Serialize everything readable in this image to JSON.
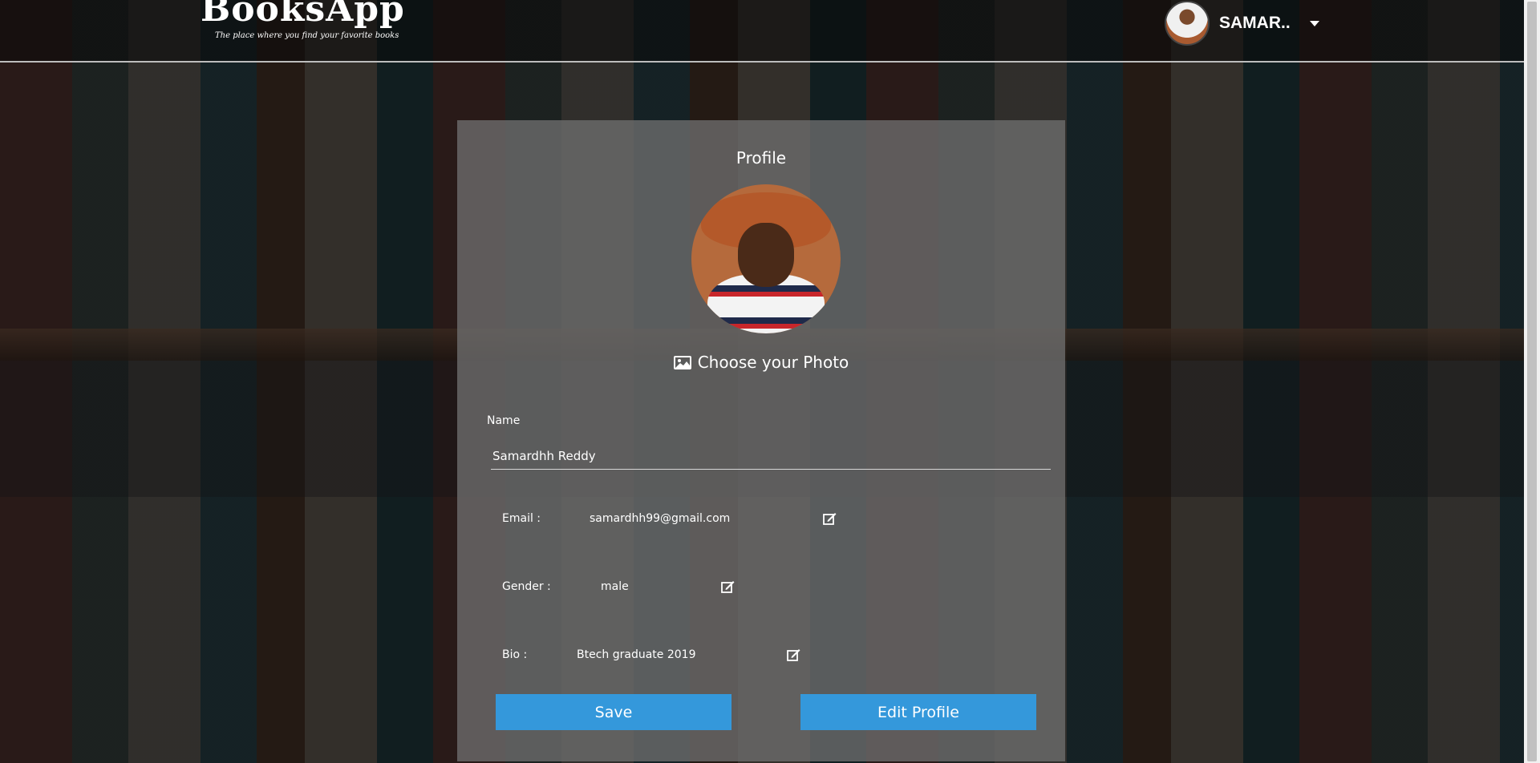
{
  "header": {
    "brand": "BooksApp",
    "tagline": "The place where you find your favorite books",
    "username": "SAMAR.."
  },
  "profile": {
    "title": "Profile",
    "choose_photo_label": "Choose your Photo",
    "name_label": "Name",
    "name_value": "Samardhh Reddy",
    "email_label": "Email :",
    "email_value": "samardhh99@gmail.com",
    "gender_label": "Gender :",
    "gender_value": "male",
    "bio_label": "Bio :",
    "bio_value": "Btech graduate 2019"
  },
  "buttons": {
    "save": "Save",
    "edit_profile": "Edit Profile"
  },
  "colors": {
    "button": "#3498db",
    "card": "#6e6e6e"
  }
}
